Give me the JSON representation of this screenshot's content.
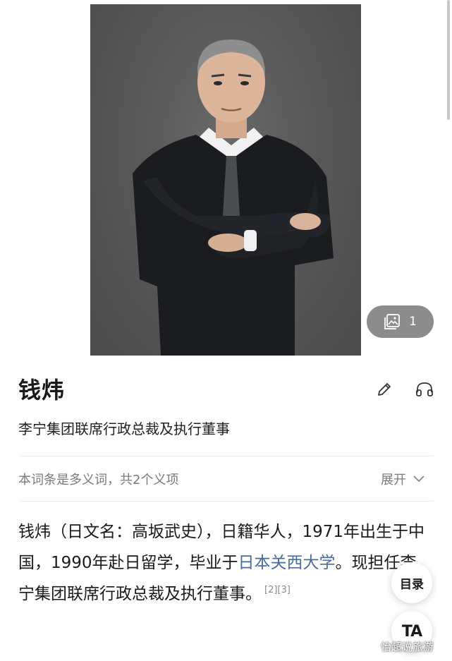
{
  "entry": {
    "name": "钱炜",
    "subtitle": "李宁集团联席行政总裁及执行董事",
    "polysemy_note": "本词条是多义词，共2个义项",
    "expand_label": "展开",
    "gallery_count": "1",
    "summary_part1": "钱炜（日文名：高坂武史），日籍华人，1971年出生于中国，1990年赴日留学，毕业于",
    "summary_link": "日本关西大学",
    "summary_part2": "。现担任李宁集团联席行政总裁及执行董事。",
    "summary_refs": "[2][3]"
  },
  "floating": {
    "toc_label": "目录",
    "font_label": "TA"
  },
  "watermark": "怡超说旅游",
  "icons": {
    "gallery": "gallery-icon",
    "edit": "pencil-icon",
    "listen": "headphones-icon",
    "expand": "chevron-down-icon"
  },
  "colors": {
    "link": "#4b6c9a",
    "muted": "#7a7a7a",
    "photo_bg": "#585858"
  }
}
